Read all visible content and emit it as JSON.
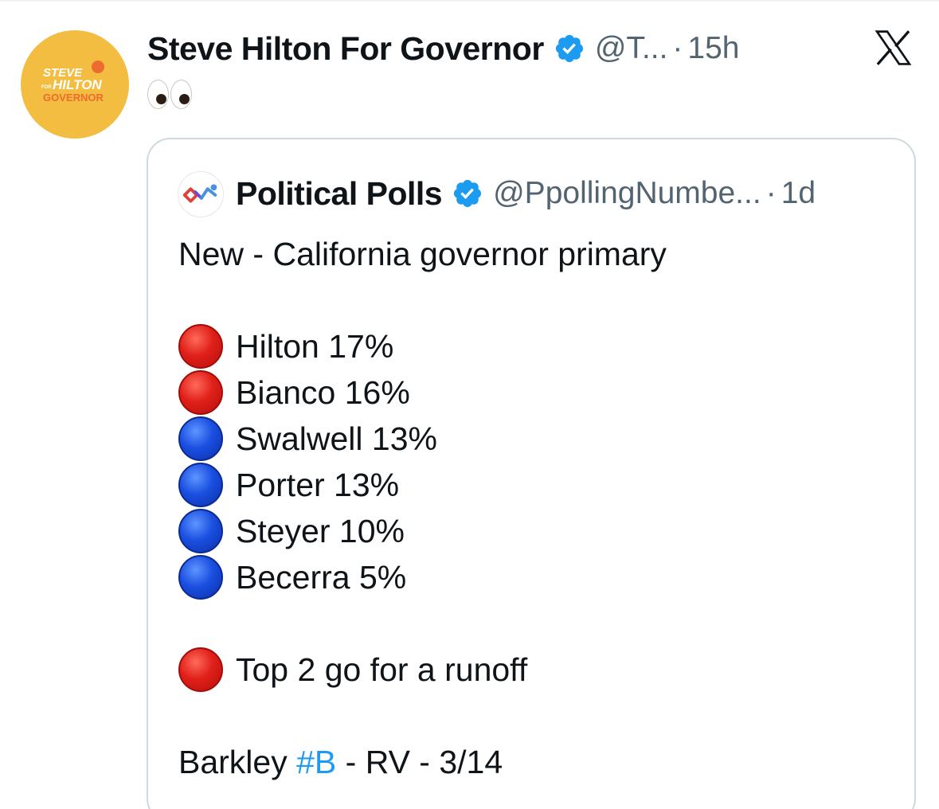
{
  "tweet": {
    "author_name": "Steve Hilton For Governor",
    "handle": "@T...",
    "separator": "·",
    "time": "15h",
    "avatar_text": [
      "STEVE",
      "FOR",
      "HILTON",
      "GOVERNOR"
    ],
    "text_emoji": "eyes"
  },
  "quoted": {
    "author_name": "Political Polls",
    "handle": "@PpollingNumbe...",
    "separator": "·",
    "time": "1d",
    "headline": "New - California governor primary",
    "results": [
      {
        "color": "red",
        "text": "Hilton 17%"
      },
      {
        "color": "red",
        "text": "Bianco 16%"
      },
      {
        "color": "blue",
        "text": "Swalwell 13%"
      },
      {
        "color": "blue",
        "text": "Porter 13%"
      },
      {
        "color": "blue",
        "text": "Steyer 10%"
      },
      {
        "color": "blue",
        "text": "Becerra 5%"
      }
    ],
    "note": {
      "color": "red",
      "text": "Top 2 go for a runoff"
    },
    "source_prefix": "Barkley ",
    "source_hashtag": "#B",
    "source_suffix": " - RV - 3/14"
  },
  "colors": {
    "avatar_bg": "#f2bd40",
    "verified_badge": "#1d9bf0",
    "secondary_text": "#536471",
    "hashtag": "#1d9bf0"
  },
  "icons": {
    "brand": "x-logo-icon",
    "verified": "verified-badge-icon"
  }
}
